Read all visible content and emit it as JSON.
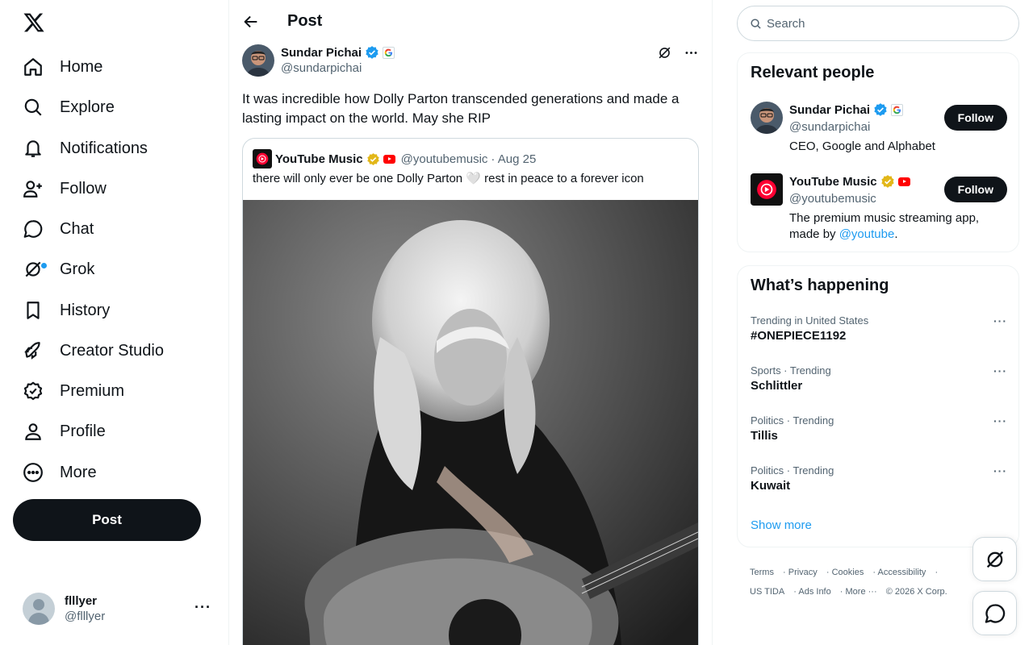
{
  "nav": {
    "items": [
      {
        "label": "Home",
        "icon": "home-icon"
      },
      {
        "label": "Explore",
        "icon": "search-icon"
      },
      {
        "label": "Notifications",
        "icon": "bell-icon"
      },
      {
        "label": "Follow",
        "icon": "add-person-icon"
      },
      {
        "label": "Chat",
        "icon": "chat-icon"
      },
      {
        "label": "Grok",
        "icon": "grok-icon"
      },
      {
        "label": "History",
        "icon": "bookmark-icon"
      },
      {
        "label": "Creator Studio",
        "icon": "rocket-icon"
      },
      {
        "label": "Premium",
        "icon": "verified-icon"
      },
      {
        "label": "Profile",
        "icon": "person-icon"
      },
      {
        "label": "More",
        "icon": "more-circle-icon"
      }
    ],
    "post_button": "Post",
    "account": {
      "name": "flllyer",
      "handle": "@flllyer"
    }
  },
  "main": {
    "title": "Post",
    "post": {
      "author_name": "Sundar Pichai",
      "author_handle": "@sundarpichai",
      "text": "It was incredible how Dolly Parton transcended generations and made a lasting impact on the world. May she RIP",
      "quote": {
        "name": "YouTube Music",
        "handle": "@youtubemusic",
        "date": "· Aug 25",
        "text": "there will only ever be one Dolly Parton 🤍 rest in peace to a forever icon"
      }
    }
  },
  "sidebar": {
    "search_placeholder": "Search",
    "relevant_title": "Relevant people",
    "people": [
      {
        "name": "Sundar Pichai",
        "handle": "@sundarpichai",
        "bio": "CEO, Google and Alphabet",
        "follow": "Follow"
      },
      {
        "name": "YouTube Music",
        "handle": "@youtubemusic",
        "bio_pre": "The premium music streaming app, made by ",
        "bio_link": "@youtube",
        "bio_post": ".",
        "follow": "Follow"
      }
    ],
    "happening_title": "What’s happening",
    "trends": [
      {
        "meta": "Trending in United States",
        "name": "#ONEPIECE1192"
      },
      {
        "meta": "Sports · Trending",
        "name": "Schlittler"
      },
      {
        "meta": "Politics · Trending",
        "name": "Tillis"
      },
      {
        "meta": "Politics · Trending",
        "name": "Kuwait"
      }
    ],
    "show_more": "Show more",
    "footer": {
      "links": [
        "Terms",
        "Privacy",
        "Cookies",
        "Accessibility",
        "US TIDA",
        "Ads Info",
        "More ···"
      ],
      "copyright": "© 2026 X Corp."
    }
  },
  "colors": {
    "accent": "#1d9bf0",
    "text": "#0f1419",
    "muted": "#536471",
    "gold": "#e2b719"
  }
}
